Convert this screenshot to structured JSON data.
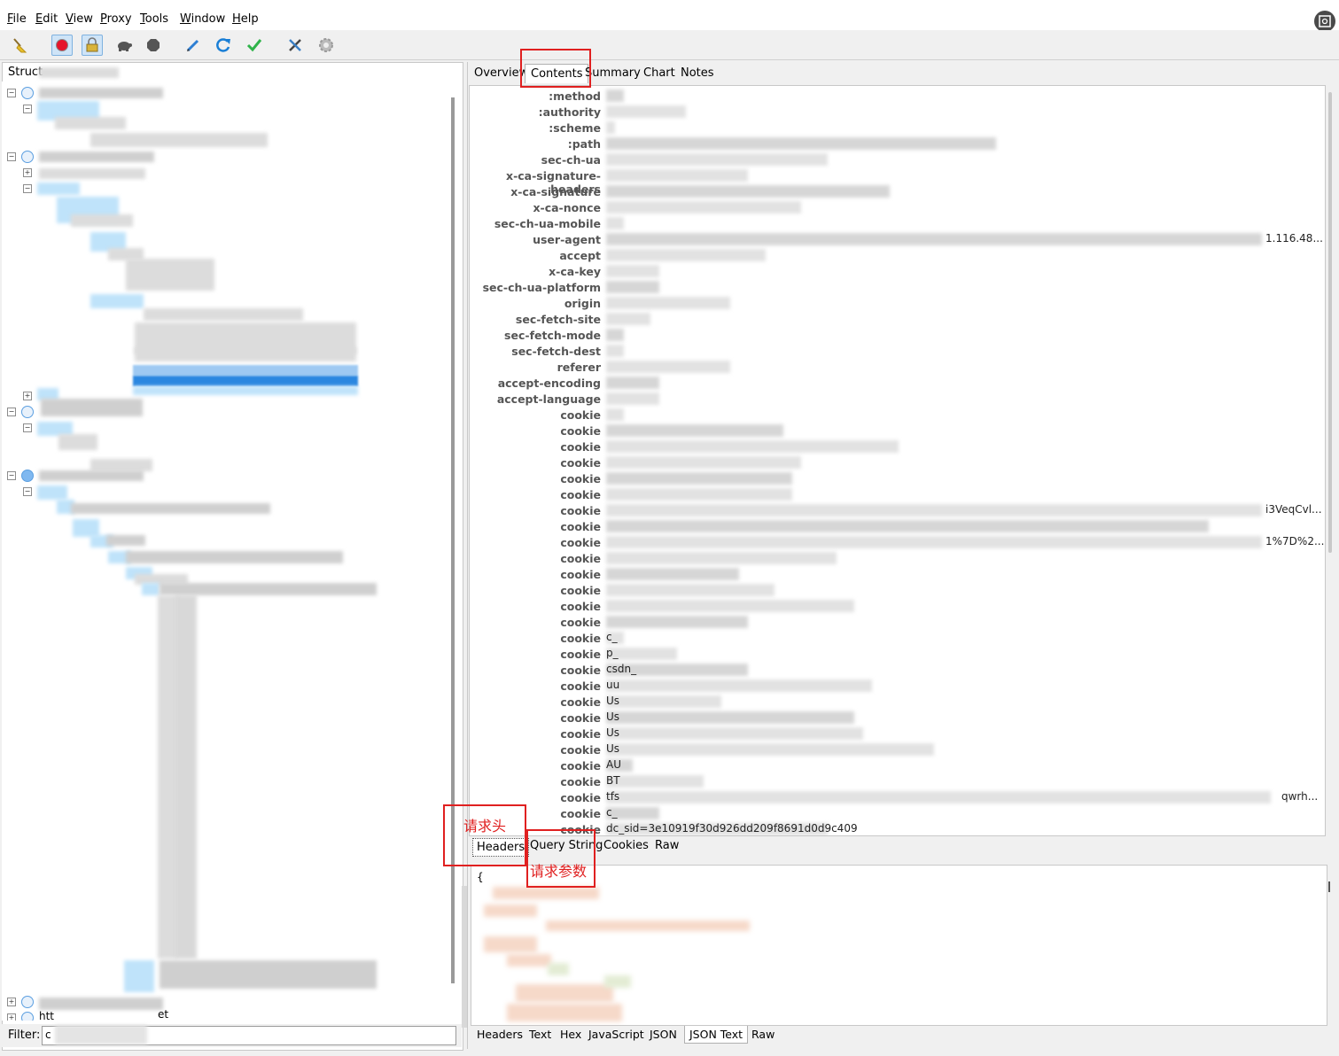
{
  "menu": {
    "items": [
      {
        "label": "File",
        "accel": "F"
      },
      {
        "label": "Edit",
        "accel": "E"
      },
      {
        "label": "View",
        "accel": "V"
      },
      {
        "label": "Proxy",
        "accel": "P"
      },
      {
        "label": "Tools",
        "accel": "T"
      },
      {
        "label": "Window",
        "accel": "W"
      },
      {
        "label": "Help",
        "accel": "H"
      }
    ]
  },
  "toolbar": {
    "icons": [
      "broom-icon",
      "record-icon",
      "ssl-proxying-icon",
      "turtle-throttle-icon",
      "stop-hexagon-icon",
      "pen-compose-icon",
      "repeat-icon",
      "validate-check-icon",
      "tools-icon",
      "settings-gear-icon"
    ]
  },
  "left": {
    "structure_label": "Struct",
    "filter_label": "Filter:",
    "filter_value": "c",
    "bottom_host_partial": "htt",
    "bottom_host_suffix": "et"
  },
  "right": {
    "tabs": [
      "Overview",
      "Contents",
      "Summary",
      "Chart",
      "Notes"
    ],
    "active_tab": "Contents",
    "header_rows": [
      {
        "name": ":method",
        "value": ""
      },
      {
        "name": ":authority",
        "value": ""
      },
      {
        "name": ":scheme",
        "value": ""
      },
      {
        "name": ":path",
        "value": ""
      },
      {
        "name": "sec-ch-ua",
        "value": ""
      },
      {
        "name": "x-ca-signature-headers",
        "value": ""
      },
      {
        "name": "x-ca-signature",
        "value": ""
      },
      {
        "name": "x-ca-nonce",
        "value": ""
      },
      {
        "name": "sec-ch-ua-mobile",
        "value": ""
      },
      {
        "name": "user-agent",
        "value": "1.116.48..."
      },
      {
        "name": "accept",
        "value": ""
      },
      {
        "name": "x-ca-key",
        "value": ""
      },
      {
        "name": "sec-ch-ua-platform",
        "value": ""
      },
      {
        "name": "origin",
        "value": ""
      },
      {
        "name": "sec-fetch-site",
        "value": ""
      },
      {
        "name": "sec-fetch-mode",
        "value": ""
      },
      {
        "name": "sec-fetch-dest",
        "value": ""
      },
      {
        "name": "referer",
        "value": ""
      },
      {
        "name": "accept-encoding",
        "value": ""
      },
      {
        "name": "accept-language",
        "value": ""
      },
      {
        "name": "cookie",
        "value": ""
      },
      {
        "name": "cookie",
        "value": ""
      },
      {
        "name": "cookie",
        "value": ""
      },
      {
        "name": "cookie",
        "value": ""
      },
      {
        "name": "cookie",
        "value": ""
      },
      {
        "name": "cookie",
        "value": ""
      },
      {
        "name": "cookie",
        "value": "i3VeqCvl..."
      },
      {
        "name": "cookie",
        "value": ""
      },
      {
        "name": "cookie",
        "value": "1%7D%2..."
      },
      {
        "name": "cookie",
        "value": ""
      },
      {
        "name": "cookie",
        "value": ""
      },
      {
        "name": "cookie",
        "value": ""
      },
      {
        "name": "cookie",
        "value": ""
      },
      {
        "name": "cookie",
        "value": ""
      },
      {
        "name": "cookie",
        "value": "c_"
      },
      {
        "name": "cookie",
        "value": "p_"
      },
      {
        "name": "cookie",
        "value": "csdn_"
      },
      {
        "name": "cookie",
        "value": "uu"
      },
      {
        "name": "cookie",
        "value": "Us"
      },
      {
        "name": "cookie",
        "value": "Us"
      },
      {
        "name": "cookie",
        "value": "Us"
      },
      {
        "name": "cookie",
        "value": "Us"
      },
      {
        "name": "cookie",
        "value": "AU"
      },
      {
        "name": "cookie",
        "value": "BT"
      },
      {
        "name": "cookie",
        "value": "tfs"
      },
      {
        "name": "cookie",
        "value": "c_"
      },
      {
        "name": "cookie",
        "value": "dc_sid=3e10919f30d926dd209f8691d0d9c409"
      }
    ],
    "tfs_suffix": "qwrh...",
    "request_tabs": [
      "Headers",
      "Query String",
      "Cookies",
      "Raw"
    ],
    "request_active": "Headers",
    "body_open_brace": "{",
    "response_tabs": [
      "Headers",
      "Text",
      "Hex",
      "JavaScript",
      "JSON",
      "JSON Text",
      "Raw"
    ],
    "response_active": "JSON Text"
  },
  "annotations": {
    "contents_note": "",
    "headers_note": "请求头",
    "query_note": "请求参数",
    "color": "#e02020"
  }
}
